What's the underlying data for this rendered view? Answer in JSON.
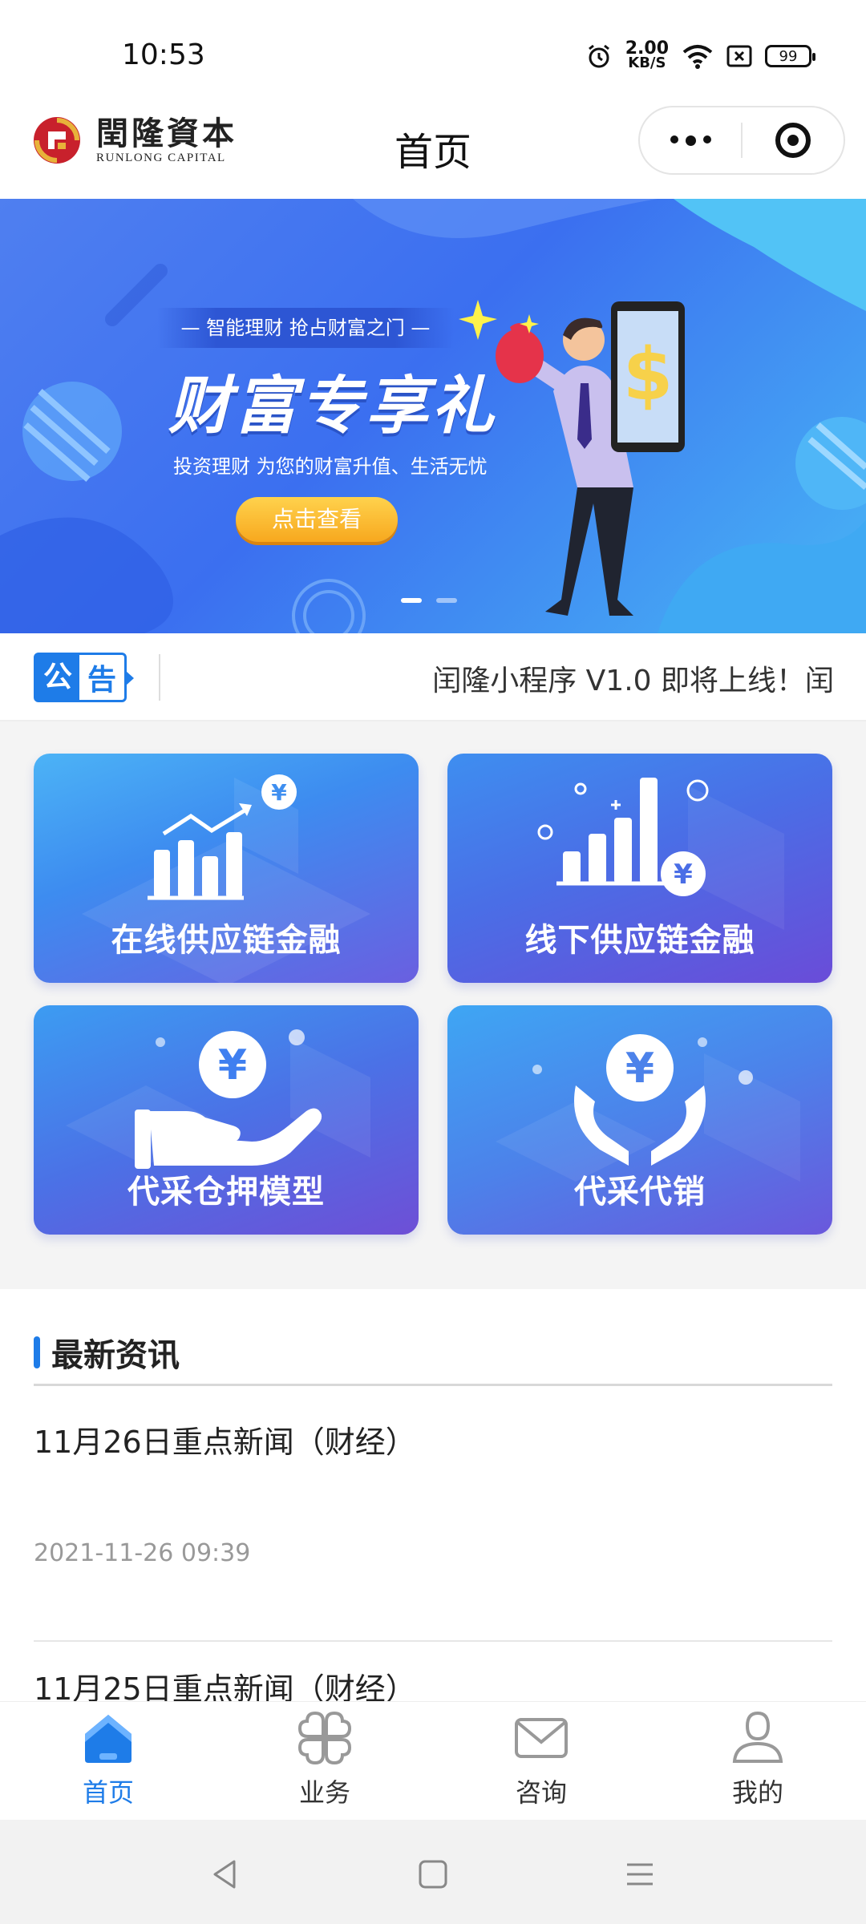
{
  "status_bar": {
    "time": "10:53",
    "net_speed_value": "2.00",
    "net_speed_unit": "KB/S",
    "battery": "99"
  },
  "title_bar": {
    "logo_cn": "閏隆資本",
    "logo_en": "RUNLONG CAPITAL",
    "title": "首页"
  },
  "banner": {
    "ribbon": "— 智能理财  抢占财富之门 —",
    "headline": "财富专享礼",
    "description": "投资理财 为您的财富升值、生活无忧",
    "button_label": "点击查看",
    "slide_count": 2,
    "active_slide": 1
  },
  "notice": {
    "tag_char1": "公",
    "tag_char2": "告",
    "text": "闰隆小程序 V1.0 即将上线！闰"
  },
  "services": [
    {
      "label": "在线供应链金融",
      "icon": "bar-chart-yen-icon"
    },
    {
      "label": "线下供应链金融",
      "icon": "growth-chart-yen-icon"
    },
    {
      "label": "代采仓押模型",
      "icon": "hand-yen-icon"
    },
    {
      "label": "代采代销",
      "icon": "hands-yen-icon"
    }
  ],
  "news": {
    "heading": "最新资讯",
    "items": [
      {
        "title": "11月26日重点新闻（财经）",
        "time": "2021-11-26 09:39"
      },
      {
        "title": "11月25日重点新闻（财经）",
        "time": ""
      }
    ]
  },
  "tabbar": {
    "items": [
      {
        "label": "首页",
        "icon": "home-icon",
        "active": true
      },
      {
        "label": "业务",
        "icon": "grid-icon",
        "active": false
      },
      {
        "label": "咨询",
        "icon": "mail-icon",
        "active": false
      },
      {
        "label": "我的",
        "icon": "user-icon",
        "active": false
      }
    ]
  },
  "colors": {
    "accent": "#1e7ce8",
    "banner_bg": "#3b6ff0",
    "button_yellow": "#f7a81e"
  }
}
